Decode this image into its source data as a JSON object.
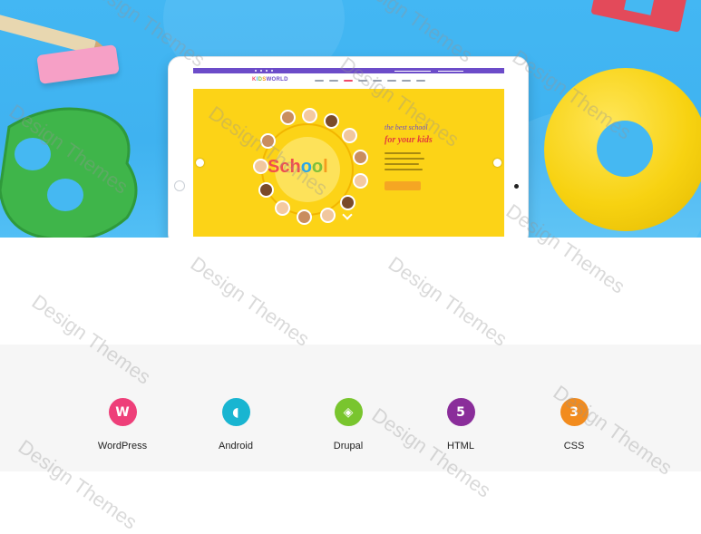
{
  "watermark_text": "Design Themes",
  "hero": {
    "logo": {
      "k": "K",
      "i": "I",
      "d": "D",
      "s": "S",
      "rest": "WORLD"
    },
    "tagline_line1": "the best school",
    "tagline_line2": "for your kids",
    "school_word": {
      "s": "S",
      "c": "c",
      "h": "h",
      "o1": "o",
      "o2": "o",
      "l": "l"
    }
  },
  "features": [
    {
      "label": "WordPress",
      "color": "#ee3f79",
      "icon": "wordpress-icon",
      "glyph": "W"
    },
    {
      "label": "Android",
      "color": "#19b5d1",
      "icon": "android-icon",
      "glyph": "◖"
    },
    {
      "label": "Drupal",
      "color": "#79c52e",
      "icon": "drupal-icon",
      "glyph": "◈"
    },
    {
      "label": "HTML",
      "color": "#8a2d9a",
      "icon": "html5-icon",
      "glyph": "5"
    },
    {
      "label": "CSS",
      "color": "#f28b1d",
      "icon": "css3-icon",
      "glyph": "3"
    }
  ]
}
